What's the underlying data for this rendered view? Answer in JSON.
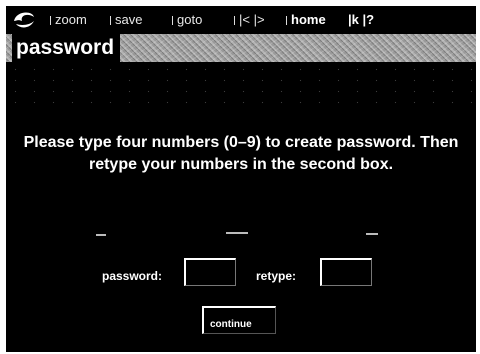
{
  "toolbar": {
    "items": [
      {
        "label": "zoom",
        "icon": "tick-mark"
      },
      {
        "label": "save",
        "icon": "tick-mark"
      },
      {
        "label": "goto",
        "icon": "tick-mark"
      },
      {
        "label": "|< |>",
        "icon": "tick-mark"
      },
      {
        "label": "home",
        "icon": "tick-mark"
      },
      {
        "label": "|k |?",
        "icon": "none"
      }
    ],
    "logo_icon": "swirl-logo-icon"
  },
  "header": {
    "title": "password"
  },
  "main": {
    "instructions": "Please type four numbers (0–9) to create password. Then retype your numbers in the second box."
  },
  "form": {
    "password_label": "password:",
    "password_value": "",
    "retype_label": "retype:",
    "retype_value": "",
    "continue_label": "continue"
  },
  "colors": {
    "background": "#000000",
    "text": "#ffffff",
    "header_band": "#8c8c8c"
  }
}
